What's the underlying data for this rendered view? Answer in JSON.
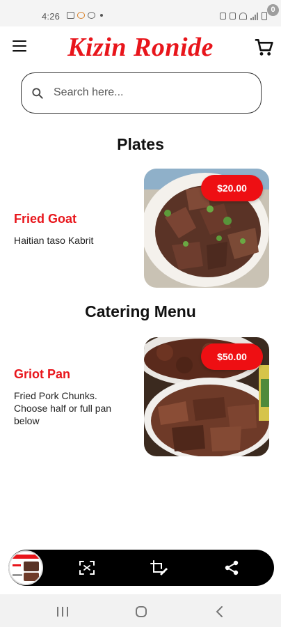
{
  "status_bar": {
    "time": "4:26"
  },
  "header": {
    "brand": "Kizin Ronide",
    "menu_icon": "hamburger-menu-icon",
    "cart_icon": "shopping-cart-icon",
    "cart_count": "0"
  },
  "search": {
    "placeholder": "Search here...",
    "value": ""
  },
  "sections": [
    {
      "title": "Plates",
      "items": [
        {
          "name": "Fried Goat",
          "description": "Haitian taso Kabrit",
          "price": "$20.00"
        }
      ]
    },
    {
      "title": "Catering Menu",
      "items": [
        {
          "name": "Griot Pan",
          "description": "Fried Pork Chunks. Choose half or full pan below",
          "price": "$50.00"
        }
      ]
    }
  ],
  "screenshot_toolbar": {
    "icons": [
      "scan-capture-icon",
      "edit-crop-icon",
      "share-icon"
    ]
  },
  "nav_bar": {
    "icons": [
      "recents-icon",
      "home-icon",
      "back-icon"
    ]
  },
  "colors": {
    "brand": "#e8151b",
    "price_badge": "#ee0f13",
    "toolbar": "#000000"
  }
}
